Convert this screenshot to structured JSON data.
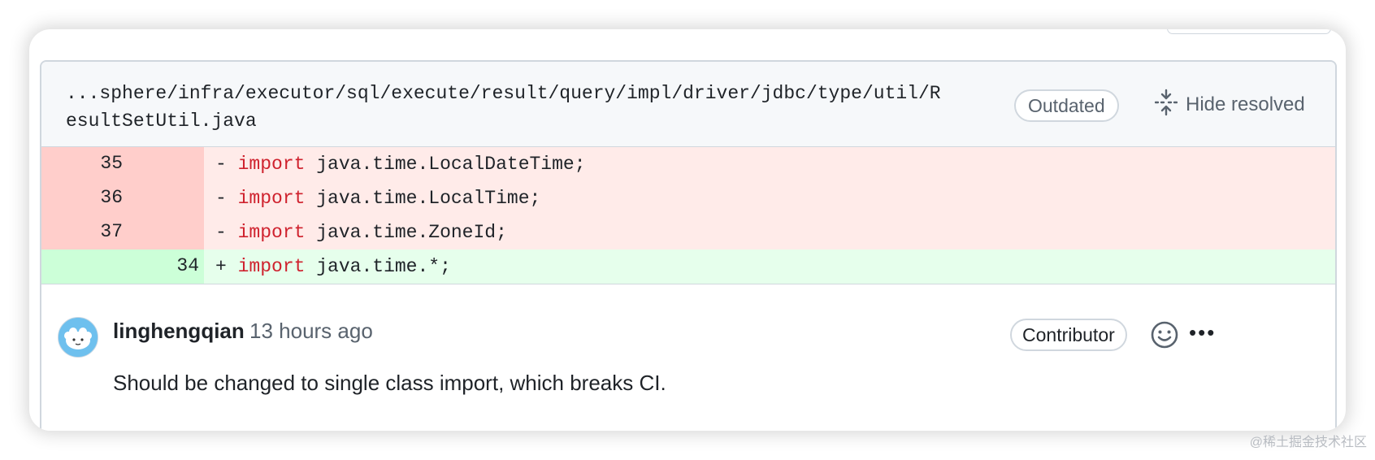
{
  "file": {
    "path": "...sphere/infra/executor/sql/execute/result/query/impl/driver/jdbc/type/util/ResultSetUtil.java",
    "outdated_label": "Outdated",
    "hide_resolved_label": "Hide resolved"
  },
  "diff": {
    "lines": [
      {
        "type": "del",
        "old": "35",
        "new": "",
        "sign": "-",
        "keyword": "import",
        "rest": " java.time.LocalDateTime;"
      },
      {
        "type": "del",
        "old": "36",
        "new": "",
        "sign": "-",
        "keyword": "import",
        "rest": " java.time.LocalTime;"
      },
      {
        "type": "del",
        "old": "37",
        "new": "",
        "sign": "-",
        "keyword": "import",
        "rest": " java.time.ZoneId;"
      },
      {
        "type": "add",
        "old": "",
        "new": "34",
        "sign": "+",
        "keyword": "import",
        "rest": " java.time.*;"
      }
    ]
  },
  "comment": {
    "author": "linghengqian",
    "time": "13 hours ago",
    "badge": "Contributor",
    "body": "Should be changed to single class import, which breaks CI.",
    "more_label": "•••"
  },
  "watermark": "@稀土掘金技术社区",
  "colors": {
    "del_gutter": "#ffcecb",
    "del_code": "#ffebe9",
    "add_gutter": "#ccffd8",
    "add_code": "#e6ffec",
    "keyword": "#cf222e"
  }
}
